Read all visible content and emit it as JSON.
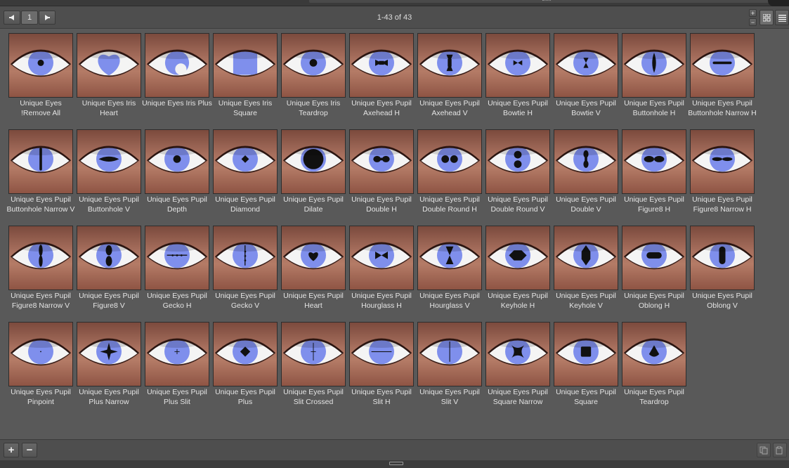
{
  "pager": {
    "page": "1",
    "count": "1-43 of 43"
  },
  "colors": {
    "iris": "#7f8fec",
    "pupil": "#111111",
    "skin": "#a8705e",
    "panel": "#595959"
  },
  "icons": {
    "prev": "triangle-left-icon",
    "next": "triangle-right-icon",
    "zoom_in": "plus-icon",
    "zoom_out": "minus-icon",
    "thumbnail_view": "grid-icon",
    "list_view": "list-icon",
    "add": "plus-icon",
    "remove": "minus-icon",
    "copy": "copy-icon",
    "paste": "paste-icon"
  },
  "items": [
    {
      "label": "Unique Eyes !Remove All",
      "shape": "none"
    },
    {
      "label": "Unique Eyes Iris Heart",
      "shape": "iris-heart"
    },
    {
      "label": "Unique Eyes Iris Plus",
      "shape": "iris-plus"
    },
    {
      "label": "Unique Eyes Iris Square",
      "shape": "iris-square"
    },
    {
      "label": "Unique Eyes Iris Teardrop",
      "shape": "iris-teardrop"
    },
    {
      "label": "Unique Eyes Pupil Axehead H",
      "shape": "bowtie-h"
    },
    {
      "label": "Unique Eyes Pupil Axehead V",
      "shape": "bowtie-v"
    },
    {
      "label": "Unique Eyes Pupil Bowtie H",
      "shape": "bowtie-h-small"
    },
    {
      "label": "Unique Eyes Pupil Bowtie V",
      "shape": "bowtie-v-small"
    },
    {
      "label": "Unique Eyes Pupil Buttonhole H",
      "shape": "buttonhole-v-tall"
    },
    {
      "label": "Unique Eyes Pupil Buttonhole Narrow H",
      "shape": "bar-h"
    },
    {
      "label": "Unique Eyes Pupil Buttonhole Narrow V",
      "shape": "bar-v"
    },
    {
      "label": "Unique Eyes Pupil Buttonhole V",
      "shape": "buttonhole-h"
    },
    {
      "label": "Unique Eyes Pupil Depth",
      "shape": "dot"
    },
    {
      "label": "Unique Eyes Pupil Diamond",
      "shape": "diamond-small"
    },
    {
      "label": "Unique Eyes Pupil Dilate",
      "shape": "dilate"
    },
    {
      "label": "Unique Eyes Pupil Double H",
      "shape": "double-h"
    },
    {
      "label": "Unique Eyes Pupil Double Round H",
      "shape": "double-round-h"
    },
    {
      "label": "Unique Eyes Pupil Double Round V",
      "shape": "double-round-v"
    },
    {
      "label": "Unique Eyes Pupil Double V",
      "shape": "double-v"
    },
    {
      "label": "Unique Eyes Pupil Figure8 H",
      "shape": "figure8-h"
    },
    {
      "label": "Unique Eyes Pupil Figure8 Narrow H",
      "shape": "figure8-narrow-h"
    },
    {
      "label": "Unique Eyes Pupil Figure8 Narrow V",
      "shape": "figure8-narrow-v"
    },
    {
      "label": "Unique Eyes Pupil Figure8 V",
      "shape": "figure8-v"
    },
    {
      "label": "Unique Eyes Pupil Gecko H",
      "shape": "gecko-h"
    },
    {
      "label": "Unique Eyes Pupil Gecko V",
      "shape": "gecko-v"
    },
    {
      "label": "Unique Eyes Pupil Heart",
      "shape": "heart"
    },
    {
      "label": "Unique Eyes Pupil Hourglass H",
      "shape": "hourglass-h"
    },
    {
      "label": "Unique Eyes Pupil Hourglass V",
      "shape": "hourglass-v"
    },
    {
      "label": "Unique Eyes Pupil Keyhole H",
      "shape": "keyhole-h"
    },
    {
      "label": "Unique Eyes Pupil Keyhole V",
      "shape": "keyhole-v"
    },
    {
      "label": "Unique Eyes Pupil Oblong H",
      "shape": "oblong-h"
    },
    {
      "label": "Unique Eyes Pupil Oblong V",
      "shape": "oblong-v"
    },
    {
      "label": "Unique Eyes Pupil Pinpoint",
      "shape": "pinpoint"
    },
    {
      "label": "Unique Eyes Pupil Plus Narrow",
      "shape": "star4"
    },
    {
      "label": "Unique Eyes Pupil Plus Slit",
      "shape": "plus-slit"
    },
    {
      "label": "Unique Eyes Pupil Plus",
      "shape": "plus-diamond"
    },
    {
      "label": "Unique Eyes Pupil Slit Crossed",
      "shape": "slit-crossed"
    },
    {
      "label": "Unique Eyes Pupil Slit H",
      "shape": "slit-h"
    },
    {
      "label": "Unique Eyes Pupil Slit V",
      "shape": "slit-v"
    },
    {
      "label": "Unique Eyes Pupil Square Narrow",
      "shape": "square-narrow"
    },
    {
      "label": "Unique Eyes Pupil Square",
      "shape": "square"
    },
    {
      "label": "Unique Eyes Pupil Teardrop",
      "shape": "teardrop"
    }
  ]
}
